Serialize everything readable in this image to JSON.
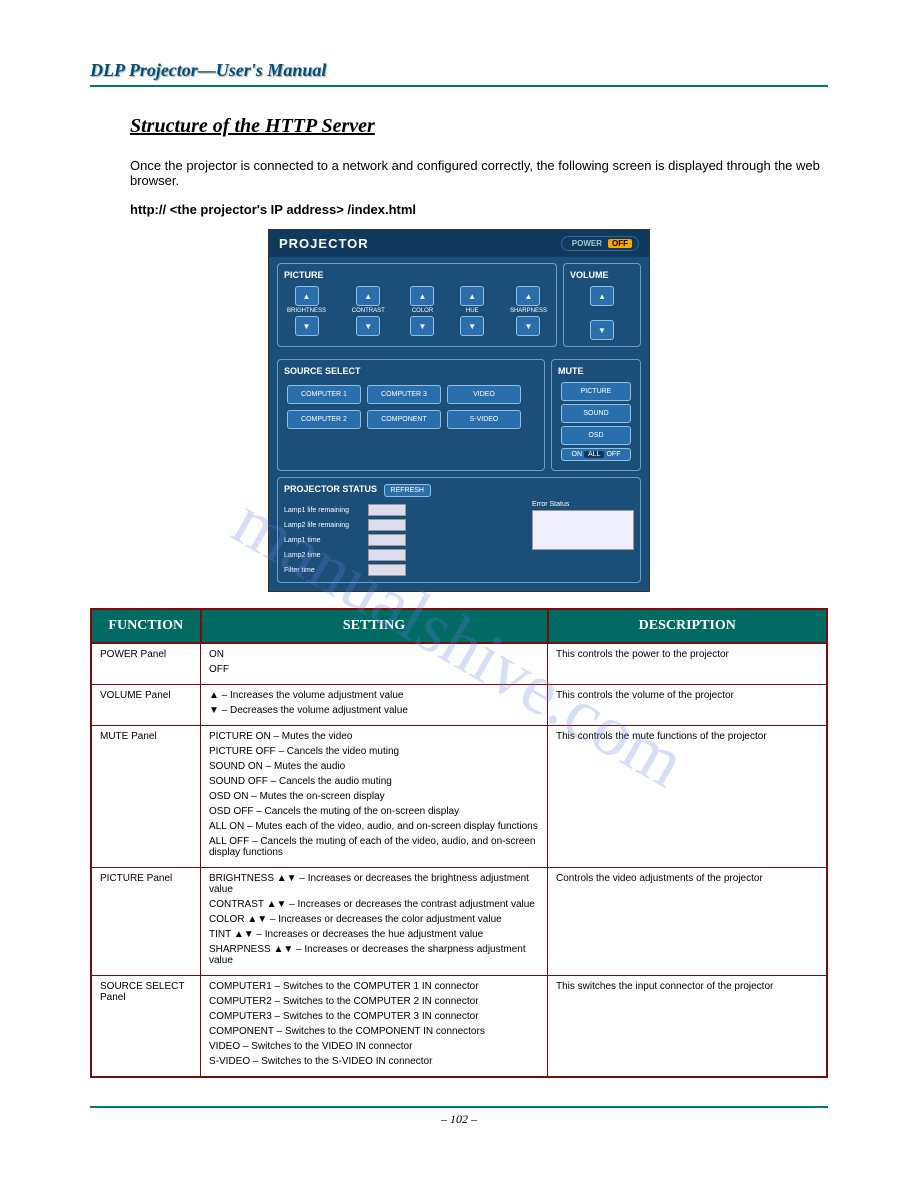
{
  "header": {
    "title": "DLP Projector—User's Manual"
  },
  "section": {
    "title": "Structure of the HTTP Server"
  },
  "intro": "Once the projector is connected to a network and configured correctly, the following screen is displayed through the web browser.",
  "url_line": "http:// <the projector's IP address> /index.html",
  "panel": {
    "title": "PROJECTOR",
    "power": {
      "on": "POWER",
      "off": "OFF"
    },
    "picture": {
      "label": "PICTURE",
      "items": [
        "BRIGHTNESS",
        "CONTRAST",
        "COLOR",
        "HUE",
        "SHARPNESS"
      ]
    },
    "volume": {
      "label": "VOLUME"
    },
    "source": {
      "label": "SOURCE SELECT",
      "buttons": [
        "COMPUTER 1",
        "COMPUTER 3",
        "VIDEO",
        "COMPUTER 2",
        "COMPONENT",
        "S-VIDEO"
      ]
    },
    "mute": {
      "label": "MUTE",
      "buttons": [
        "PICTURE",
        "SOUND",
        "OSD"
      ],
      "all": {
        "on": "ON",
        "mid": "ALL",
        "off": "OFF"
      }
    },
    "status": {
      "label": "PROJECTOR STATUS",
      "refresh": "REFRESH",
      "rows": [
        "Lamp1 life remaining",
        "Lamp2 life remaining",
        "Lamp1 time",
        "Lamp2 time",
        "Filter time"
      ],
      "error_label": "Error Status"
    }
  },
  "table": {
    "headers": {
      "func": "FUNCTION",
      "set": "SETTING",
      "desc": "DESCRIPTION"
    },
    "rows": [
      {
        "func": "POWER Panel",
        "set": [
          "ON",
          "OFF"
        ],
        "desc": "This controls the power to the projector"
      },
      {
        "func": "VOLUME Panel",
        "set": [
          "▲ – Increases the volume adjustment value",
          "▼ – Decreases the volume adjustment value"
        ],
        "desc": "This controls the volume of the projector"
      },
      {
        "func": "MUTE Panel",
        "set": [
          "PICTURE ON – Mutes the video",
          "PICTURE OFF – Cancels the video muting",
          "SOUND ON – Mutes the audio",
          "SOUND OFF – Cancels the audio muting",
          "OSD ON – Mutes the on-screen display",
          "OSD OFF – Cancels the muting of the on-screen display",
          "ALL ON – Mutes each of the video, audio, and on-screen display functions",
          "ALL OFF – Cancels the muting of each of the video, audio, and on-screen display functions"
        ],
        "desc": "This controls the mute functions of the projector"
      },
      {
        "func": "PICTURE Panel",
        "set": [
          "BRIGHTNESS ▲▼ – Increases or decreases the brightness adjustment value",
          "CONTRAST ▲▼ – Increases or decreases the contrast adjustment value",
          "COLOR ▲▼ – Increases or decreases the color adjustment value",
          "TINT ▲▼ – Increases or decreases the hue adjustment value",
          "SHARPNESS ▲▼ – Increases or decreases the sharpness adjustment value"
        ],
        "desc": "Controls the video adjustments of the projector"
      },
      {
        "func": "SOURCE SELECT Panel",
        "set": [
          "COMPUTER1 – Switches to the COMPUTER 1 IN connector",
          "COMPUTER2 – Switches to the COMPUTER 2 IN connector",
          "COMPUTER3 – Switches to the COMPUTER 3 IN connector",
          "COMPONENT – Switches to the COMPONENT IN connectors",
          "VIDEO – Switches to the VIDEO IN connector",
          "S-VIDEO – Switches to the S-VIDEO IN connector"
        ],
        "desc": "This switches the input connector of the projector"
      }
    ]
  },
  "page_number": "– 102 –",
  "watermark": "manualshive.com"
}
